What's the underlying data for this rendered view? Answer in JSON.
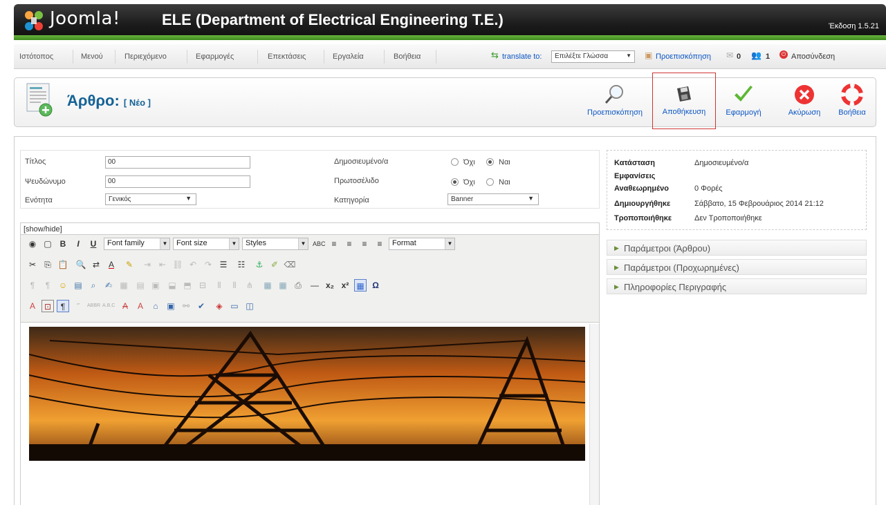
{
  "header": {
    "logo_text": "Joomla!",
    "site_title": "ELE (Department of Electrical Engineering T.E.)",
    "version": "Έκδοση 1.5.21"
  },
  "menubar": {
    "items": [
      "Ιστότοπος",
      "Μενού",
      "Περιεχόμενο",
      "Εφαρμογές",
      "Επεκτάσεις",
      "Εργαλεία",
      "Βοήθεια"
    ],
    "translate_label": "translate to:",
    "language_select": "Επιλέξτε Γλώσσα",
    "preview_link": "Προεπισκόπηση",
    "messages_count": "0",
    "users_count": "1",
    "logout": "Αποσύνδεση"
  },
  "toolbar": {
    "title": "Άρθρο:",
    "title_suffix": "[ Νέο ]",
    "buttons": {
      "preview": "Προεπισκόπηση",
      "save": "Αποθήκευση",
      "apply": "Εφαρμογή",
      "cancel": "Ακύρωση",
      "help": "Βοήθεια"
    }
  },
  "form": {
    "title_label": "Τίτλος",
    "title_value": "00",
    "alias_label": "Ψευδώνυμο",
    "alias_value": "00",
    "section_label": "Ενότητα",
    "section_value": "Γενικός",
    "published_label": "Δημοσιευμένο/α",
    "frontpage_label": "Πρωτοσέλιδο",
    "category_label": "Κατηγορία",
    "category_value": "Banner",
    "radio_no": "Όχι",
    "radio_yes": "Ναι",
    "published_selected": "yes",
    "frontpage_selected": "no"
  },
  "editor": {
    "showhide": "[show/hide]",
    "font_family": "Font family",
    "font_size": "Font size",
    "styles": "Styles",
    "format": "Format"
  },
  "status": {
    "state_label": "Κατάσταση",
    "state_value": "Δημοσιευμένο/α",
    "hits_label": "Εμφανίσεις",
    "revised_label": "Αναθεωρημένο",
    "revised_value": "0 Φορές",
    "created_label": "Δημιουργήθηκε",
    "created_value": "Σάββατο, 15 Φεβρουάριος 2014 21:12",
    "modified_label": "Τροποποιήθηκε",
    "modified_value": "Δεν Τροποποιήθηκε"
  },
  "accordion": [
    "Παράμετροι (Άρθρου)",
    "Παράμετροι (Προχωρημένες)",
    "Πληροφορίες Περιγραφής"
  ],
  "colors": {
    "header_dark": "#1a1a1a",
    "header_green": "#5aa532",
    "link_blue": "#0b55c4",
    "title_blue": "#146295",
    "save_highlight": "#cc3333"
  }
}
